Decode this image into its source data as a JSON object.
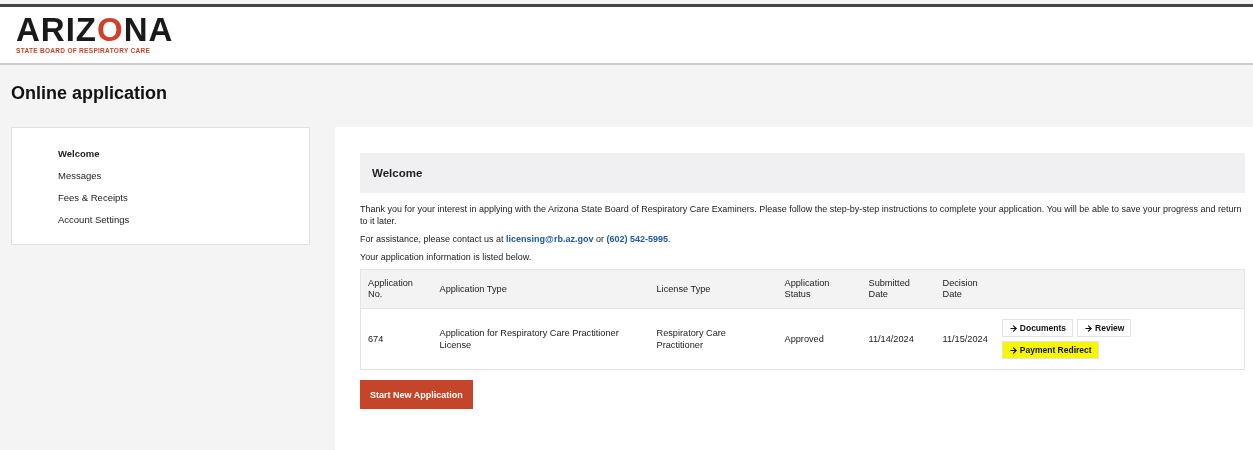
{
  "logo": {
    "wordmark_parts": [
      "ARIZ",
      "O",
      "NA"
    ],
    "subtitle": "STATE BOARD OF RESPIRATORY CARE"
  },
  "page_title": "Online application",
  "sidebar": {
    "items": [
      {
        "label": "Welcome",
        "selected": true
      },
      {
        "label": "Messages",
        "selected": false
      },
      {
        "label": "Fees & Receipts",
        "selected": false
      },
      {
        "label": "Account Settings",
        "selected": false
      }
    ]
  },
  "main": {
    "heading": "Welcome",
    "intro": "Thank you for your interest in applying with the Arizona State Board of Respiratory Care Examiners. Please follow the step-by-step instructions to complete your application. You will be able to save your progress and return to it later.",
    "contact": {
      "prefix": "For assistance, please contact us at",
      "email": "licensing@rb.az.gov",
      "joiner": "or",
      "phone": "(602) 542-5995",
      "suffix": "."
    },
    "note": "Your application information is listed below.",
    "table": {
      "columns": [
        "Application No.",
        "Application Type",
        "License Type",
        "Application Status",
        "Submitted Date",
        "Decision Date"
      ],
      "rows": [
        {
          "cells": [
            "674",
            "Application for Respiratory Care Practitioner License",
            "Respiratory Care Practitioner",
            "Approved",
            "11/14/2024",
            "11/15/2024"
          ],
          "actions": [
            {
              "label": "Documents",
              "highlighted": false
            },
            {
              "label": "Review",
              "highlighted": false
            },
            {
              "label": "Payment Redirect",
              "highlighted": true
            }
          ]
        }
      ]
    },
    "start_button": "Start New Application"
  }
}
